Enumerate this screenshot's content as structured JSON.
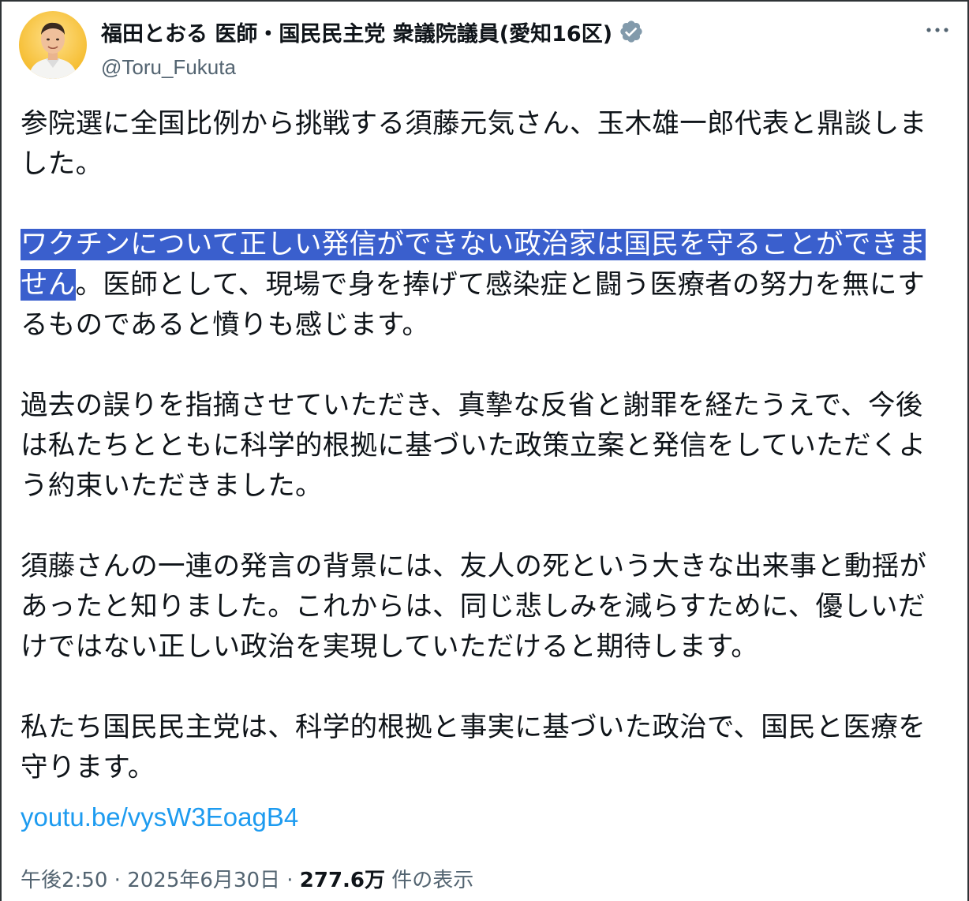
{
  "author": {
    "display_name": "福田とおる 医師・国民民主党 衆議院議員(愛知16区)",
    "handle": "@Toru_Fukuta",
    "avatar_icon": "avatar-photo",
    "verified_icon": "verified-badge-icon",
    "verified_color": "#829aab"
  },
  "more_menu": {
    "icon": "more-options-icon"
  },
  "tweet": {
    "p1": "参院選に全国比例から挑戦する須藤元気さん、玉木雄一郎代表と鼎談しました。",
    "p2_highlight": "ワクチンについて正しい発信ができない政治家は国民を守ることができません",
    "p2_rest": "。医師として、現場で身を捧げて感染症と闘う医療者の努力を無にするものであると憤りも感じます。",
    "p3": "過去の誤りを指摘させていただき、真摯な反省と謝罪を経たうえで、今後は私たちとともに科学的根拠に基づいた政策立案と発信をしていただくよう約束いただきました。",
    "p4": "須藤さんの一連の発言の背景には、友人の死という大きな出来事と動揺があったと知りました。これからは、同じ悲しみを減らすために、優しいだけではない正しい政治を実現していただけると期待します。",
    "p5": "私たち国民民主党は、科学的根拠と事実に基づいた政治で、国民と医療を守ります。",
    "link": "youtu.be/vysW3EoagB4"
  },
  "meta": {
    "time": "午後2:50",
    "sep1": " · ",
    "date": "2025年6月30日",
    "sep2": " · ",
    "views_count": "277.6万",
    "views_label": " 件の表示"
  },
  "colors": {
    "highlight_bg": "#3a5fcd",
    "link": "#1d9bf0",
    "secondary_text": "#536471",
    "primary_text": "#0f1419"
  }
}
